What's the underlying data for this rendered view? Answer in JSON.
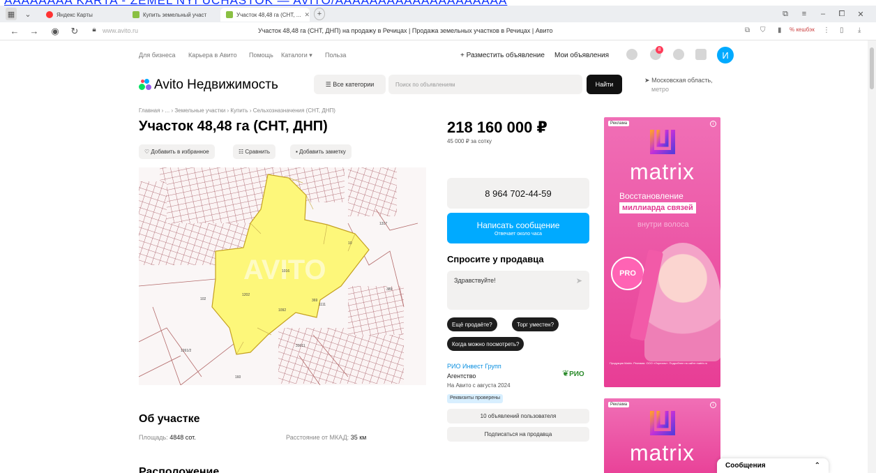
{
  "top_link": "AAAAAAAA KARTA - ZEMEL'NYI UCHASTOK — AVITO/AAAAAAAAAAAAAAAAAAAA",
  "browser": {
    "tabs": [
      {
        "label": "Яндекс Карты",
        "color": "#ff3333"
      },
      {
        "label": "Купить земельный участ",
        "color": "#8ac043"
      },
      {
        "label": "Участок 48,48 га (СНТ, ...",
        "color": "#8ac043",
        "active": true
      }
    ],
    "new_tab": "+",
    "window_controls": [
      "⧉",
      "≡",
      "–",
      "⧠",
      "✕"
    ],
    "url": "www.avito.ru",
    "page_title": "Участок 48,48 га (СНТ, ДНП) на продажу в Речицах | Продажа земельных участков в Речицах | Авито",
    "cashback": "% кешбэк"
  },
  "header": {
    "links": [
      "Для бизнеса",
      "Карьера в Авито",
      "Помощь",
      "Каталоги ▾",
      "Польза"
    ],
    "post_ad": "+ Разместить объявление",
    "my_ads": "Мои объявления",
    "notif_count": "8",
    "avatar_letter": "И",
    "logo_text": "Avito Недвижимость",
    "categories_btn": "☰ Все категории",
    "search_placeholder": "Поиск по объявлениям",
    "find_btn": "Найти",
    "region": "Московская область,",
    "region_sub": "метро"
  },
  "listing": {
    "breadcrumb": "Главная › ... › Земельные участки › Купить › Сельхозназначения (СНТ, ДНП)",
    "title": "Участок 48,48 га (СНТ, ДНП)",
    "actions": [
      "♡ Добавить в избранное",
      "☷ Сравнить",
      "▪ Добавить заметку"
    ],
    "price": "218 160 000 ₽",
    "price_per": "45 000 ₽ за сотку",
    "phone": "8 964 702-44-59",
    "message_btn": "Написать сообщение",
    "message_sub": "Отвечает около часа",
    "ask_title": "Спросите у продавца",
    "ask_text": "Здравствуйте!",
    "quick_questions": [
      "Ещё продаёте?",
      "Торг уместен?",
      "Когда можно посмотреть?"
    ],
    "seller_name": "РИО Инвест Групп",
    "seller_type": "Агентство",
    "seller_since": "На Авито с августа 2024",
    "seller_badge": "Реквизиты проверены",
    "seller_logo": "РИО",
    "user_ads_btn": "10 объявлений пользователя",
    "subscribe_btn": "Подписаться на продавца",
    "about_title": "Об участке",
    "area_label": "Площадь:",
    "area_value": "4848 сот.",
    "mkad_label": "Расстояние от МКАД:",
    "mkad_value": "35 км",
    "location_title": "Расположение",
    "map_labels": [
      "AVITO",
      "1317",
      "1016",
      "389",
      "1111",
      "1202",
      "102",
      "1092",
      "31011",
      "1261/2",
      "369",
      "160",
      "10"
    ]
  },
  "ads": {
    "label": "Реклама",
    "brand": "matrix",
    "line1": "Восстановление",
    "line2": "миллиарда связей",
    "line3": "внутри волоса",
    "badge": "PRO",
    "fine_print": "Продукция Matrix. Реклама. ООО «Лореаль». Подробнее на сайте matrix.ru"
  },
  "chat": {
    "label": "Сообщения",
    "chevron": "⌃"
  }
}
